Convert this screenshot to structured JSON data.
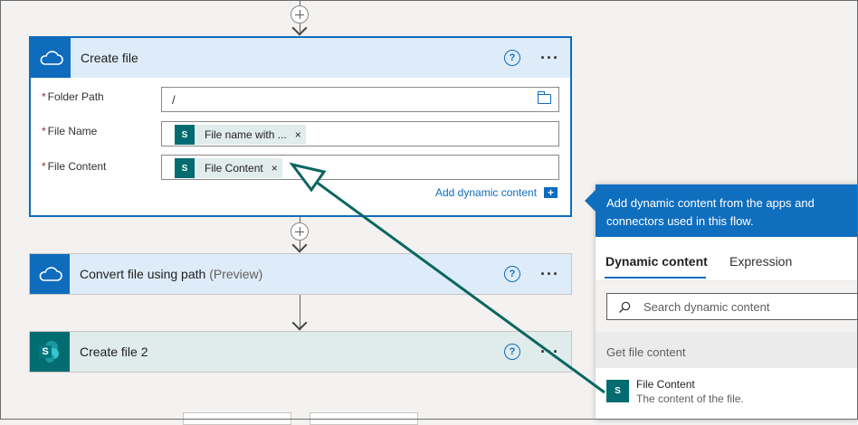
{
  "cards": {
    "create_file": {
      "title": "Create file",
      "help": "?",
      "more": "···",
      "fields": {
        "folder_path": {
          "required_mark": "*",
          "label": "Folder Path",
          "value": "/"
        },
        "file_name": {
          "required_mark": "*",
          "label": "File Name",
          "token": "File name with ...",
          "token_remove": "×"
        },
        "file_content": {
          "required_mark": "*",
          "label": "File Content",
          "token": "File Content",
          "token_remove": "×"
        }
      },
      "add_dynamic_link": "Add dynamic content",
      "add_dynamic_icon": "+"
    },
    "convert_file": {
      "title": "Convert file using path",
      "preview": "(Preview)",
      "help": "?",
      "more": "···"
    },
    "create_file_2": {
      "title": "Create file 2",
      "help": "?",
      "more": "···"
    }
  },
  "sharepoint_badge": "S",
  "dynamic_panel": {
    "header": "Add dynamic content from the apps and connectors used in this flow.",
    "tabs": [
      "Dynamic content",
      "Expression"
    ],
    "search_placeholder": "Search dynamic content",
    "group_label": "Get file content",
    "items": [
      {
        "title": "File Content",
        "description": "The content of the file."
      }
    ]
  },
  "colors": {
    "accent_blue": "#0f6cbd",
    "sharepoint_teal": "#036c70",
    "annotation_arrow": "#0b6660",
    "card_header_blue": "#deecf9"
  }
}
